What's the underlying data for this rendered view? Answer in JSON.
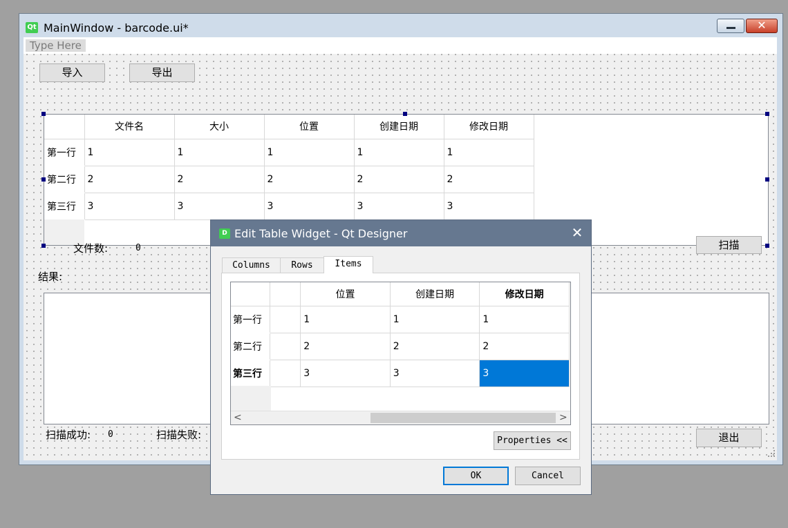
{
  "main_window": {
    "title": "MainWindow - barcode.ui*",
    "logo_text": "Qt",
    "close_glyph": "✕",
    "menu_placeholder": "Type Here",
    "buttons": {
      "import": "导入",
      "export": "导出",
      "scan": "扫描",
      "exit": "退出"
    },
    "table": {
      "columns": [
        "文件名",
        "大小",
        "位置",
        "创建日期",
        "修改日期"
      ],
      "rows": [
        {
          "header": "第一行",
          "cells": [
            "1",
            "1",
            "1",
            "1",
            "1"
          ]
        },
        {
          "header": "第二行",
          "cells": [
            "2",
            "2",
            "2",
            "2",
            "2"
          ]
        },
        {
          "header": "第三行",
          "cells": [
            "3",
            "3",
            "3",
            "3",
            "3"
          ]
        }
      ]
    },
    "labels": {
      "file_count": "文件数:",
      "file_count_value": "0",
      "result": "结果:",
      "scan_success": "扫描成功:",
      "scan_success_value": "0",
      "scan_fail": "扫描失败:"
    }
  },
  "dialog": {
    "title": "Edit Table Widget - Qt Designer",
    "logo_text": "D",
    "close_glyph": "✕",
    "tabs": [
      "Columns",
      "Rows",
      "Items"
    ],
    "active_tab": "Items",
    "table": {
      "columns": [
        "",
        "位置",
        "创建日期",
        "修改日期"
      ],
      "rows": [
        {
          "header": "第一行",
          "cells": [
            "",
            "1",
            "1",
            "1"
          ]
        },
        {
          "header": "第二行",
          "cells": [
            "",
            "2",
            "2",
            "2"
          ]
        },
        {
          "header": "第三行",
          "cells": [
            "",
            "3",
            "3",
            "3"
          ]
        }
      ],
      "selected_cell": "3"
    },
    "scroll_left": "<",
    "scroll_right": ">",
    "properties_button": "Properties <<",
    "ok_button": "OK",
    "cancel_button": "Cancel"
  },
  "colors": {
    "selection": "#0078d7",
    "dialog_titlebar": "#667890",
    "qt_green": "#41cd52"
  }
}
